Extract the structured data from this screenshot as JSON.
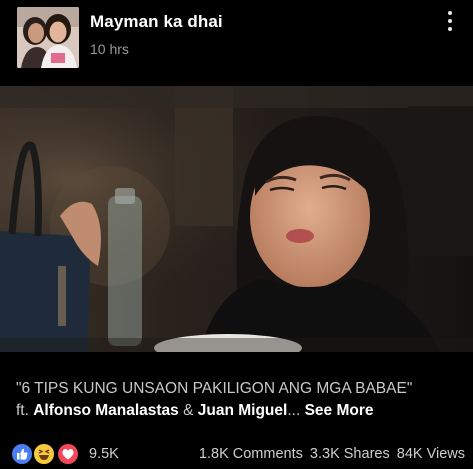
{
  "post": {
    "page_name": "Mayman ka dhai",
    "timestamp": "10 hrs"
  },
  "caption": {
    "line1": "\"6 TIPS KUNG UNSAON PAKILIGON ANG MGA BABAE\"",
    "prefix": "ft. ",
    "name1": "Alfonso Manalastas",
    "amp": " & ",
    "name2": "Juan Miguel",
    "ellipsis": "... ",
    "see_more": "See More"
  },
  "engagement": {
    "reaction_icons": [
      "like-icon",
      "haha-icon",
      "love-icon"
    ],
    "reaction_count": "9.5K",
    "comments": "1.8K Comments",
    "shares": "3.3K Shares",
    "views": "84K Views"
  },
  "colors": {
    "background": "#000000",
    "like": "#4a7ef0",
    "haha": "#f7c93e",
    "love": "#f0485a",
    "muted_text": "#9a9a9a"
  }
}
